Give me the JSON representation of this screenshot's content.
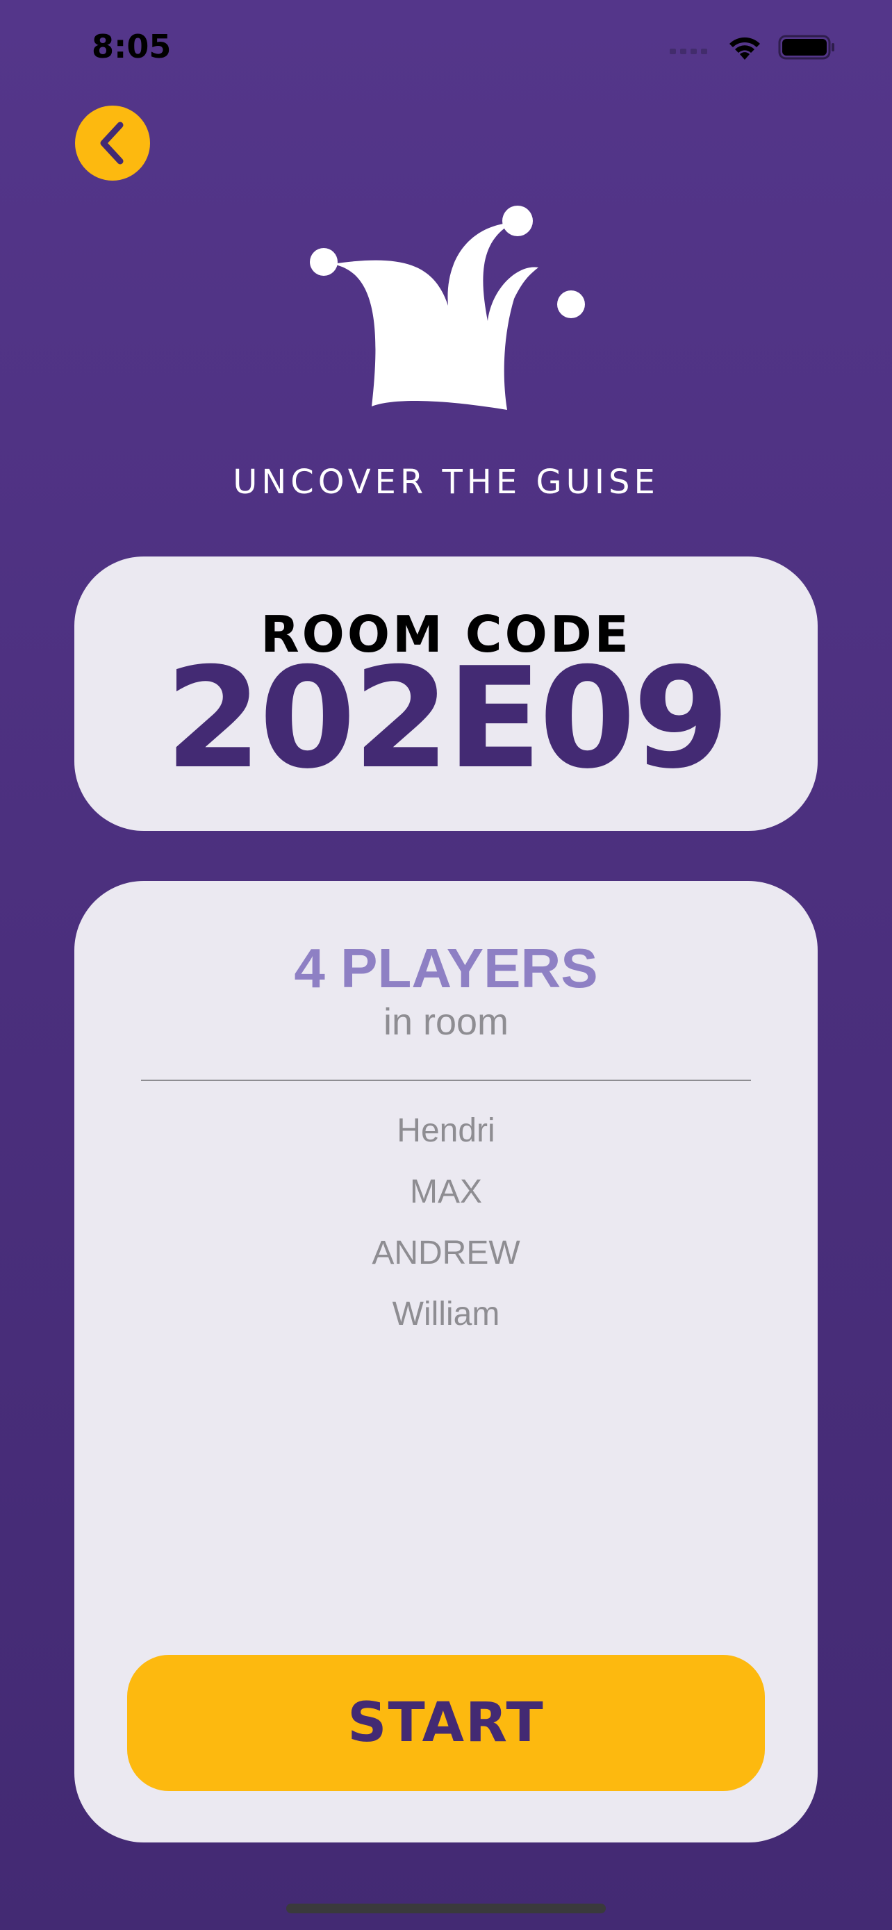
{
  "status_bar": {
    "time": "8:05"
  },
  "header": {
    "back_icon": "chevron-left-icon"
  },
  "brand": {
    "logo_icon": "jester-hat-icon",
    "tagline": "UNCOVER THE GUISE"
  },
  "room": {
    "label": "ROOM CODE",
    "code": "202E09"
  },
  "players": {
    "count_label": "4 PLAYERS",
    "subtitle": "in room",
    "list": [
      "Hendri",
      "MAX",
      "ANDREW",
      "William"
    ]
  },
  "actions": {
    "start_label": "START"
  },
  "colors": {
    "accent": "#fdb90f",
    "primary": "#432a73",
    "background": "#54368a",
    "card": "#ebe9f1",
    "players_highlight": "#8e80c4"
  }
}
